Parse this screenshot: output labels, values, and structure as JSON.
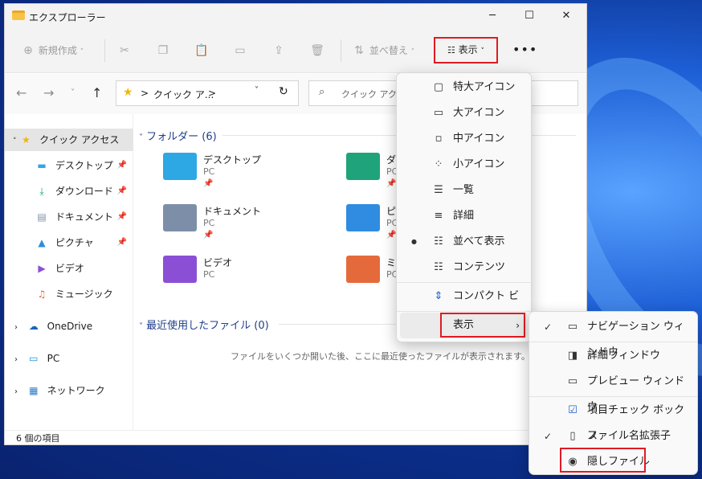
{
  "window": {
    "title": "エクスプローラー",
    "minimize": "─",
    "maximize": "☐",
    "close": "✕"
  },
  "toolbar": {
    "new_label": "新規作成",
    "sort_label": "並べ替え",
    "view_label": "表示",
    "more_label": "•••"
  },
  "address": {
    "path_current": "クイック ア...",
    "path_sep": ">",
    "search_placeholder": "クイック アクセス"
  },
  "sidebar": {
    "quick_access": "クイック アクセス",
    "items": [
      {
        "label": "デスクトップ",
        "icon": "desktop-icon",
        "pinned": true
      },
      {
        "label": "ダウンロード",
        "icon": "download-icon",
        "pinned": true
      },
      {
        "label": "ドキュメント",
        "icon": "document-icon",
        "pinned": true
      },
      {
        "label": "ピクチャ",
        "icon": "picture-icon",
        "pinned": true
      },
      {
        "label": "ビデオ",
        "icon": "video-icon",
        "pinned": false
      },
      {
        "label": "ミュージック",
        "icon": "music-icon",
        "pinned": false
      }
    ],
    "onedrive": "OneDrive",
    "pc": "PC",
    "network": "ネットワーク"
  },
  "content": {
    "folders_header": "フォルダー (6)",
    "recent_header": "最近使用したファイル (0)",
    "folders": [
      {
        "name": "デスクトップ",
        "sub": "PC",
        "color": "#2ea8e5"
      },
      {
        "name": "ダ",
        "sub": "PC",
        "color": "#1fa37a"
      },
      {
        "name": "ドキュメント",
        "sub": "PC",
        "color": "#7d8fa8"
      },
      {
        "name": "ピ",
        "sub": "PC",
        "color": "#2f8ce0"
      },
      {
        "name": "ビデオ",
        "sub": "PC",
        "color": "#8b4fd6"
      },
      {
        "name": "ミ",
        "sub": "PC",
        "color": "#e56a3b"
      }
    ],
    "empty_message": "ファイルをいくつか開いた後、ここに最近使ったファイルが表示されます。"
  },
  "statusbar": {
    "count": "6 個の項目"
  },
  "view_menu": {
    "items": [
      {
        "label": "特大アイコン",
        "icon": "extra-large-icons-icon"
      },
      {
        "label": "大アイコン",
        "icon": "large-icons-icon"
      },
      {
        "label": "中アイコン",
        "icon": "medium-icons-icon"
      },
      {
        "label": "小アイコン",
        "icon": "small-icons-icon"
      },
      {
        "label": "一覧",
        "icon": "list-icon"
      },
      {
        "label": "詳細",
        "icon": "details-icon"
      },
      {
        "label": "並べて表示",
        "icon": "tiles-icon",
        "selected": true
      },
      {
        "label": "コンテンツ",
        "icon": "content-icon"
      },
      {
        "label": "コンパクト ビュー",
        "icon": "compact-view-icon"
      },
      {
        "label": "表示",
        "icon": "",
        "submenu": true
      }
    ]
  },
  "show_submenu": {
    "items": [
      {
        "label": "ナビゲーション ウィンドウ",
        "checked": true,
        "icon": "navigation-pane-icon"
      },
      {
        "label": "詳細ウィンドウ",
        "checked": false,
        "icon": "details-pane-icon"
      },
      {
        "label": "プレビュー ウィンドウ",
        "checked": false,
        "icon": "preview-pane-icon"
      },
      {
        "label": "項目チェック ボックス",
        "checked": false,
        "icon": "item-checkbox-icon"
      },
      {
        "label": "ファイル名拡張子",
        "checked": true,
        "icon": "file-extension-icon"
      },
      {
        "label": "隠しファイル",
        "checked": false,
        "icon": "hidden-files-icon"
      }
    ]
  },
  "colors": {
    "accent_red": "#e01b24",
    "link_blue": "#1f3f8a"
  }
}
